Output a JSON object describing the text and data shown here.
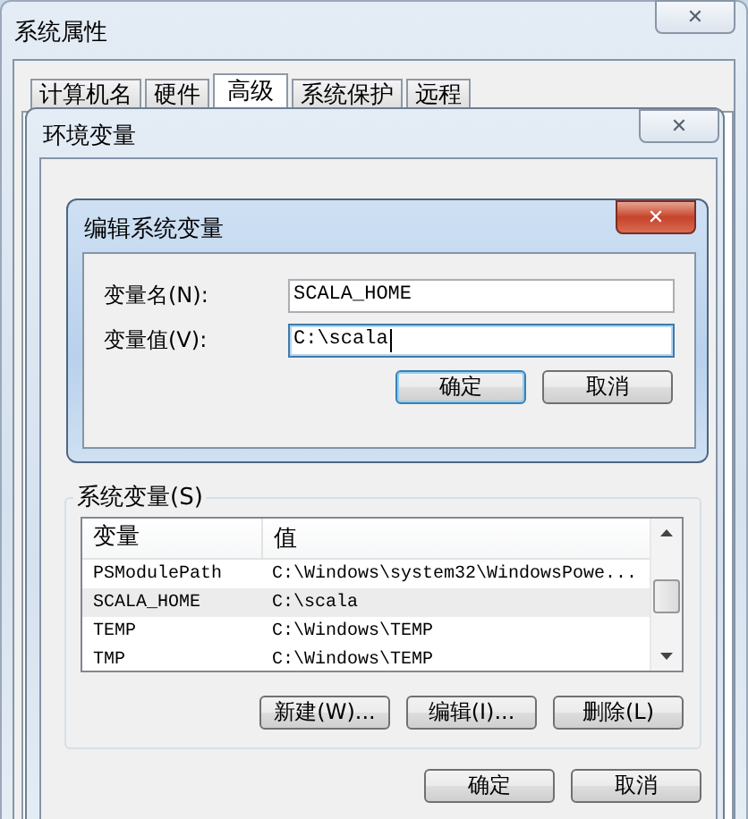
{
  "system_properties": {
    "title": "系统属性",
    "close": "✕",
    "tabs": [
      {
        "label": "计算机名",
        "selected": false
      },
      {
        "label": "硬件",
        "selected": false
      },
      {
        "label": "高级",
        "selected": true
      },
      {
        "label": "系统保护",
        "selected": false
      },
      {
        "label": "远程",
        "selected": false
      }
    ]
  },
  "environment_variables": {
    "title": "环境变量",
    "close": "✕",
    "system_variables": {
      "label": "系统变量(S)",
      "columns": [
        "变量",
        "值"
      ],
      "rows": [
        {
          "name": "PSModulePath",
          "value": "C:\\Windows\\system32\\WindowsPowe...",
          "selected": false
        },
        {
          "name": "SCALA_HOME",
          "value": "C:\\scala",
          "selected": true
        },
        {
          "name": "TEMP",
          "value": "C:\\Windows\\TEMP",
          "selected": false
        },
        {
          "name": "TMP",
          "value": "C:\\Windows\\TEMP",
          "selected": false
        }
      ],
      "buttons": [
        "新建(W)...",
        "编辑(I)...",
        "删除(L)"
      ]
    },
    "buttons": [
      {
        "label": "确定",
        "default": false
      },
      {
        "label": "取消",
        "default": false
      }
    ]
  },
  "edit_dialog": {
    "title": "编辑系统变量",
    "close": "✕",
    "fields": [
      {
        "label": "变量名(N):",
        "value": "SCALA_HOME",
        "focused": false
      },
      {
        "label": "变量值(V):",
        "value": "C:\\scala",
        "focused": true
      }
    ],
    "buttons": [
      {
        "label": "确定",
        "default": true
      },
      {
        "label": "取消",
        "default": false
      }
    ]
  }
}
